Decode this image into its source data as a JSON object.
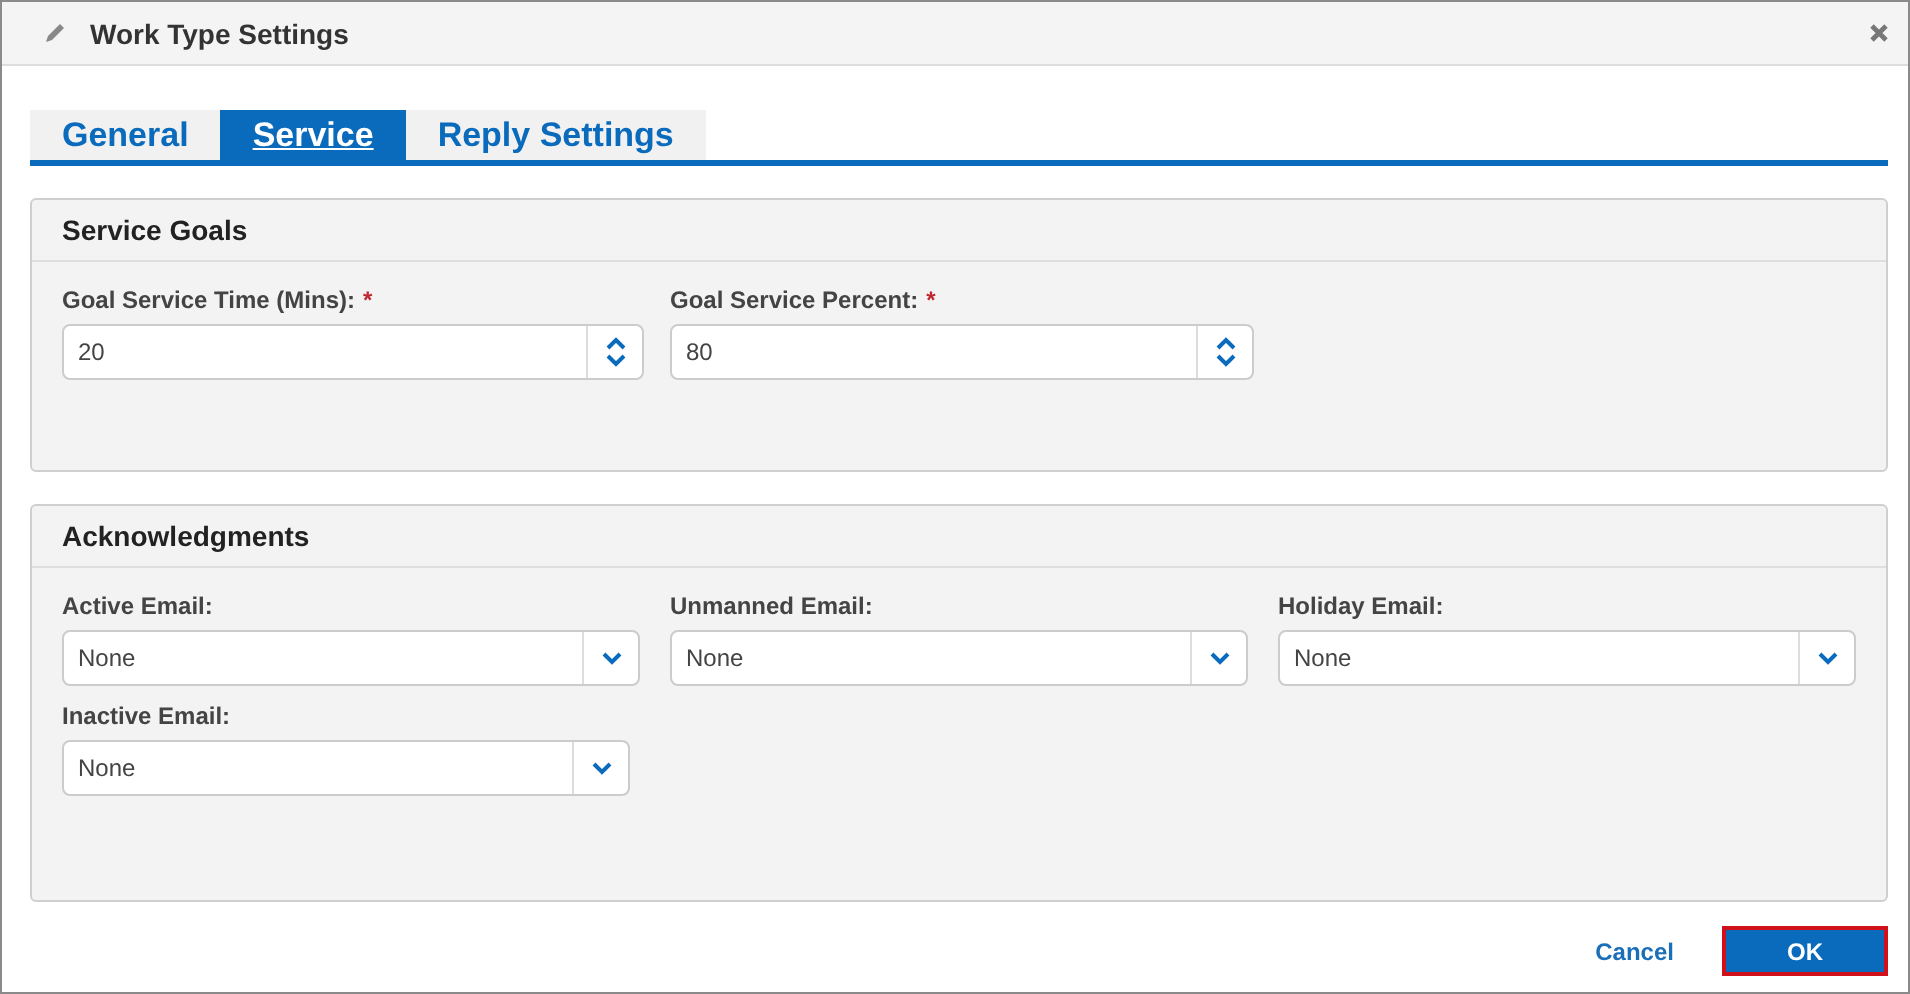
{
  "window": {
    "title": "Work Type Settings"
  },
  "tabs": [
    {
      "label": "General",
      "selected": false
    },
    {
      "label": "Service",
      "selected": true
    },
    {
      "label": "Reply Settings",
      "selected": false
    }
  ],
  "sections": [
    {
      "title": "Service Goals",
      "fields": [
        {
          "kind": "spinner",
          "label": "Goal Service Time (Mins):",
          "required_mark": "*",
          "value": "20"
        },
        {
          "kind": "spinner",
          "label": "Goal Service Percent:",
          "required_mark": "*",
          "value": "80"
        }
      ]
    },
    {
      "title": "Acknowledgments",
      "fields": [
        {
          "kind": "select",
          "label": "Active Email:",
          "value": "None"
        },
        {
          "kind": "select",
          "label": "Unmanned Email:",
          "value": "None"
        },
        {
          "kind": "select",
          "label": "Holiday Email:",
          "value": "None"
        },
        {
          "kind": "select",
          "label": "Inactive Email:",
          "value": "None"
        }
      ]
    }
  ],
  "buttons": [
    {
      "kind": "link",
      "label": "Cancel",
      "highlighted": false
    },
    {
      "kind": "primary",
      "label": "OK",
      "highlighted": true
    }
  ]
}
